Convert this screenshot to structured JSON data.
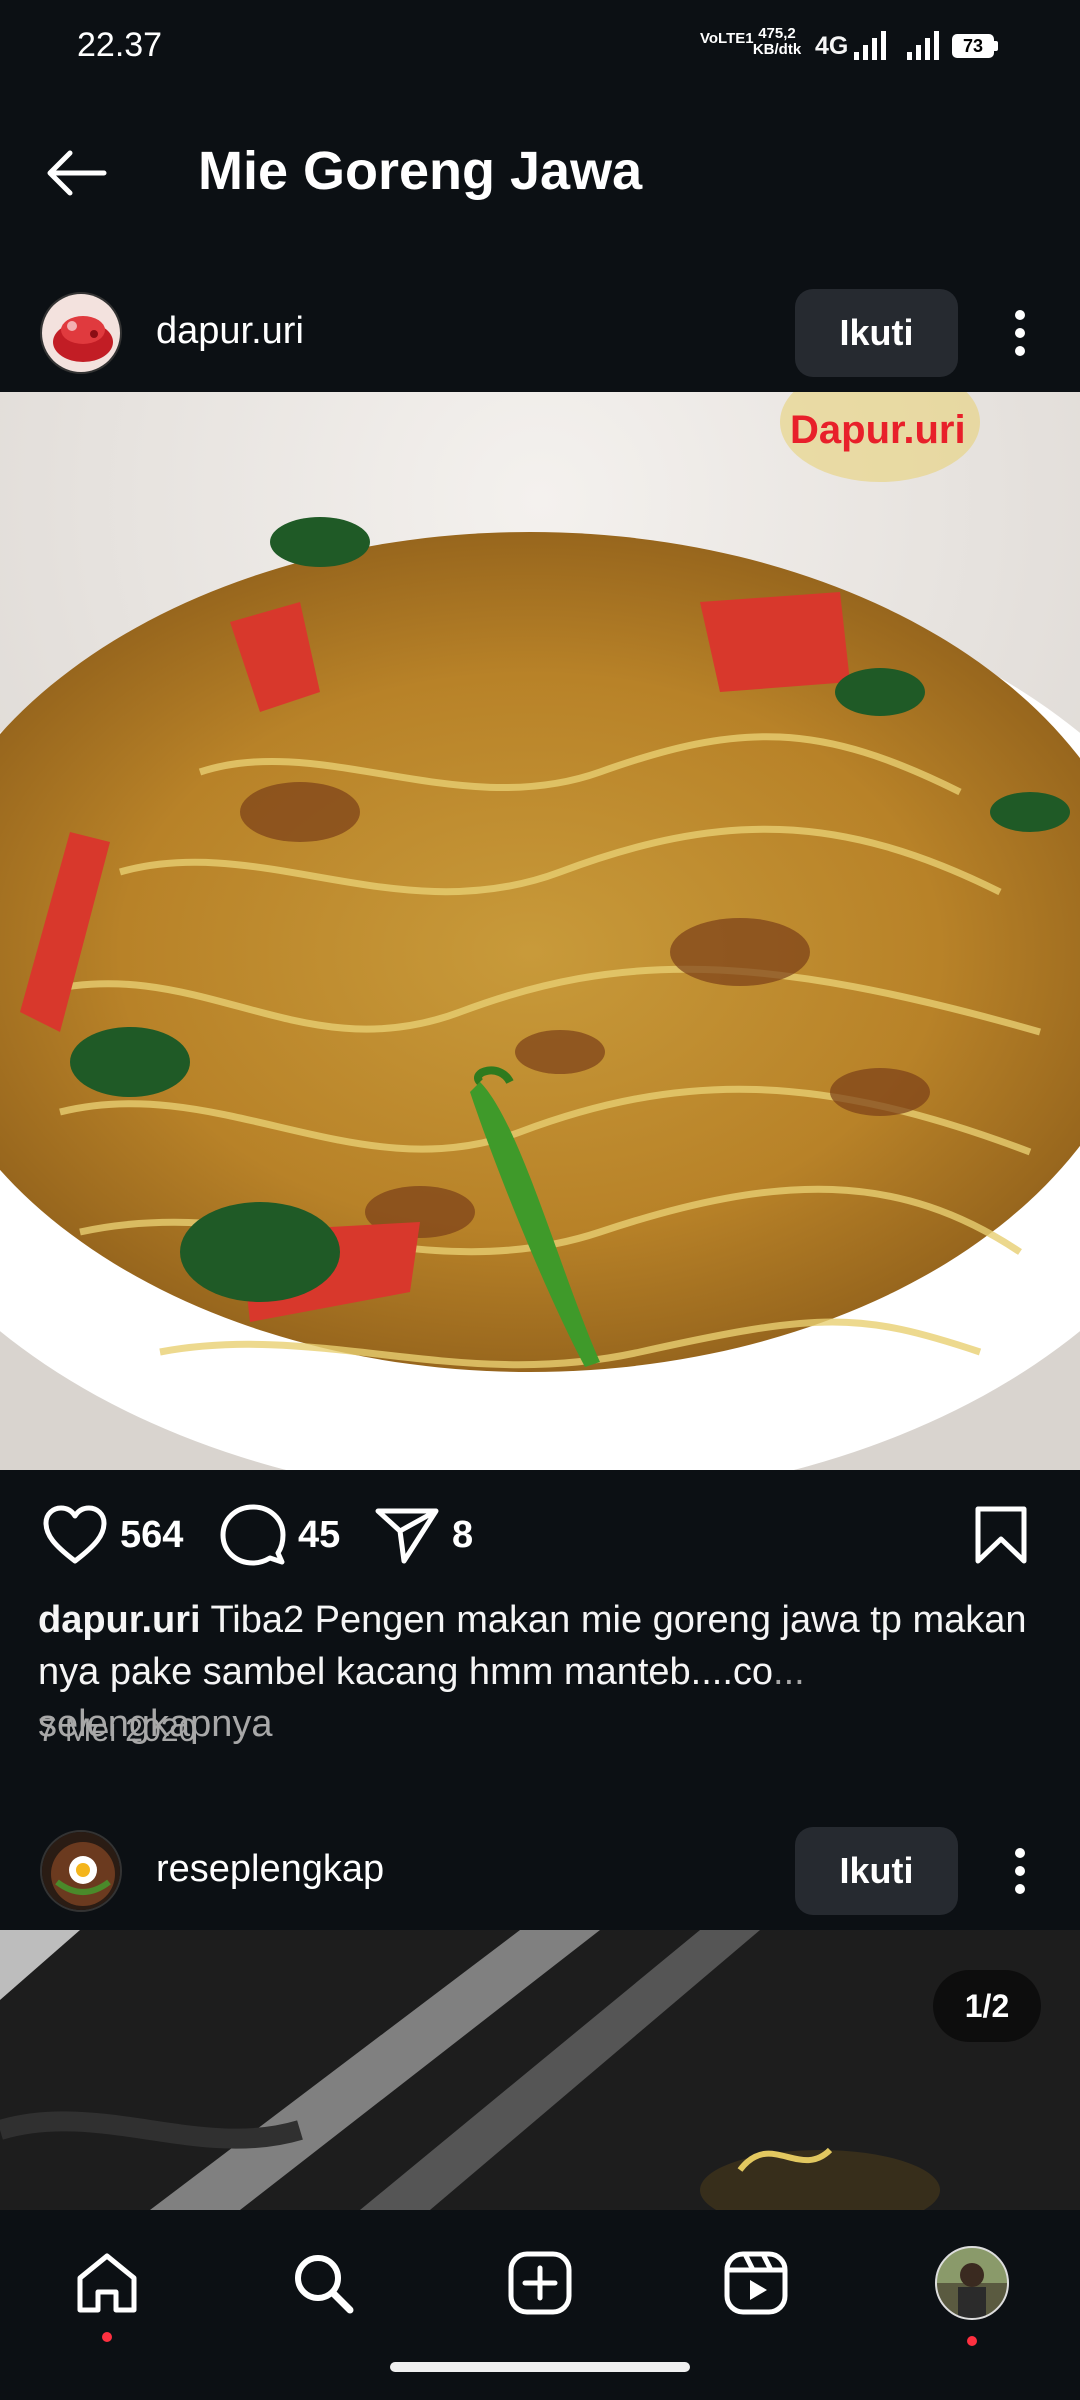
{
  "status_bar": {
    "time": "22.37",
    "volte": "VoLTE1",
    "speed_value": "475,2",
    "speed_unit": "KB/dtk",
    "network": "4G",
    "battery": "73"
  },
  "header": {
    "title": "Mie Goreng Jawa"
  },
  "posts": [
    {
      "username": "dapur.uri",
      "follow_label": "Ikuti",
      "watermark": "Dapur.uri",
      "likes": "564",
      "comments": "45",
      "shares": "8",
      "caption_username": "dapur.uri",
      "caption_text": "Tiba2 Pengen makan mie goreng jawa tp makan nya pake sambel kacang hmm manteb....co",
      "caption_more": "... selengkapnya",
      "date": "7 Mei 2020"
    },
    {
      "username": "reseplengkap",
      "follow_label": "Ikuti",
      "carousel_counter": "1/2"
    }
  ],
  "bottom_nav": {
    "items": [
      "home-icon",
      "search-icon",
      "create-icon",
      "reels-icon",
      "profile-avatar"
    ]
  },
  "colors": {
    "background": "#0c1014",
    "button": "#262a30",
    "muted_text": "#a8a8a8",
    "notification_dot": "#ff3040"
  }
}
